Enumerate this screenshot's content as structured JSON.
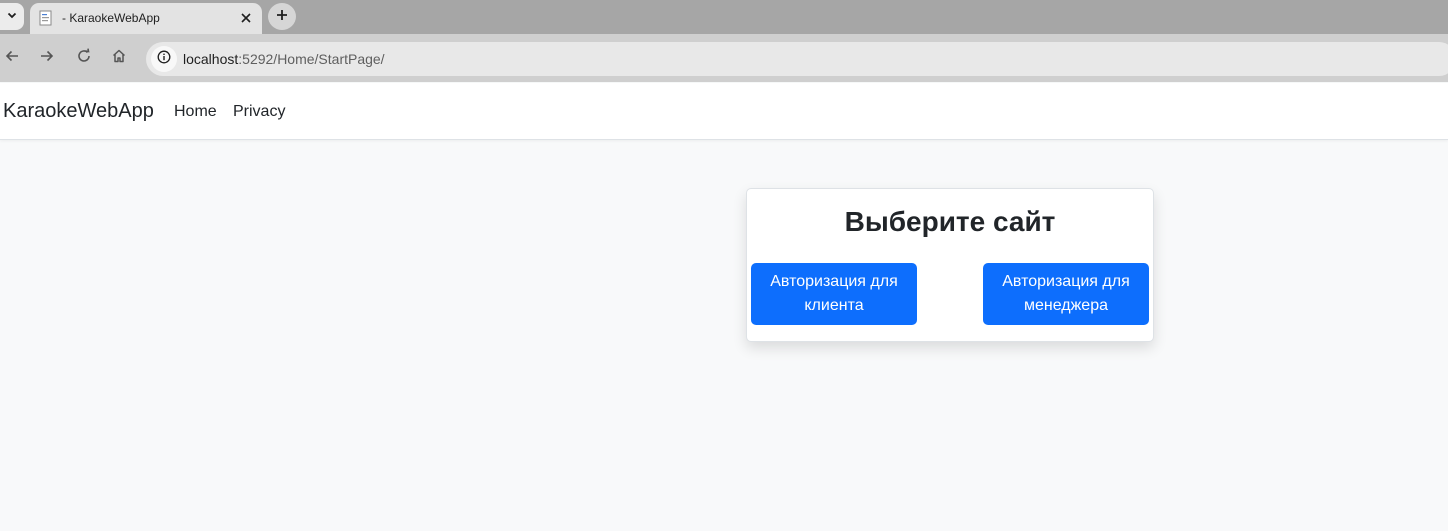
{
  "browser": {
    "tab_title": "- KaraokeWebApp",
    "url_host": "localhost",
    "url_rest": ":5292/Home/StartPage/"
  },
  "icons": {
    "tab_search": "chevron-down-icon",
    "favicon": "page-icon",
    "close": "close-icon",
    "new_tab": "plus-icon",
    "back": "arrow-left-icon",
    "forward": "arrow-right-icon",
    "reload": "reload-icon",
    "home": "home-icon",
    "site_info": "info-icon"
  },
  "navbar": {
    "brand": "KaraokeWebApp",
    "links": [
      "Home",
      "Privacy"
    ]
  },
  "card": {
    "title": "Выберите сайт",
    "buttons": [
      "Авторизация для клиента",
      "Авторизация для менеджера"
    ]
  },
  "colors": {
    "primary": "#0d6efd",
    "page_bg": "#f8f9fa"
  }
}
